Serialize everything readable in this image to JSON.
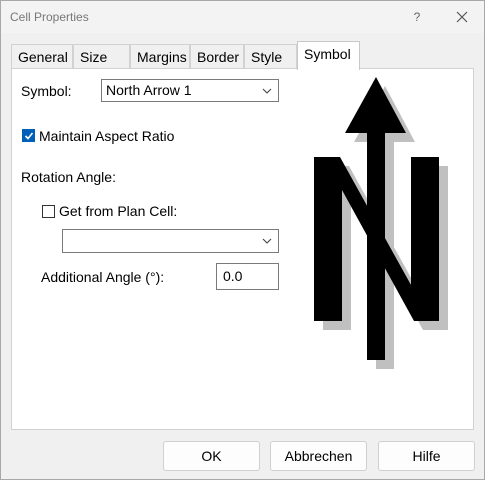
{
  "window": {
    "title": "Cell Properties",
    "help_glyph": "?"
  },
  "tabs": [
    {
      "label": "General",
      "active": false
    },
    {
      "label": "Size",
      "active": false
    },
    {
      "label": "Margins",
      "active": false
    },
    {
      "label": "Border",
      "active": false
    },
    {
      "label": "Style",
      "active": false
    },
    {
      "label": "Symbol",
      "active": true
    }
  ],
  "symbol_tab": {
    "symbol_label": "Symbol:",
    "symbol_value": "North Arrow 1",
    "maintain_aspect_label": "Maintain Aspect Ratio",
    "maintain_aspect_checked": true,
    "rotation_label": "Rotation Angle:",
    "get_from_plan_label": "Get from Plan Cell:",
    "get_from_plan_checked": false,
    "plan_cell_value": "",
    "additional_angle_label": "Additional Angle (°):",
    "additional_angle_value": "0.0",
    "preview_icon": "north-arrow-icon"
  },
  "buttons": {
    "ok": "OK",
    "cancel": "Abbrechen",
    "help": "Hilfe"
  },
  "colors": {
    "accent": "#005fb8",
    "shadow": "#c0c0c0"
  }
}
